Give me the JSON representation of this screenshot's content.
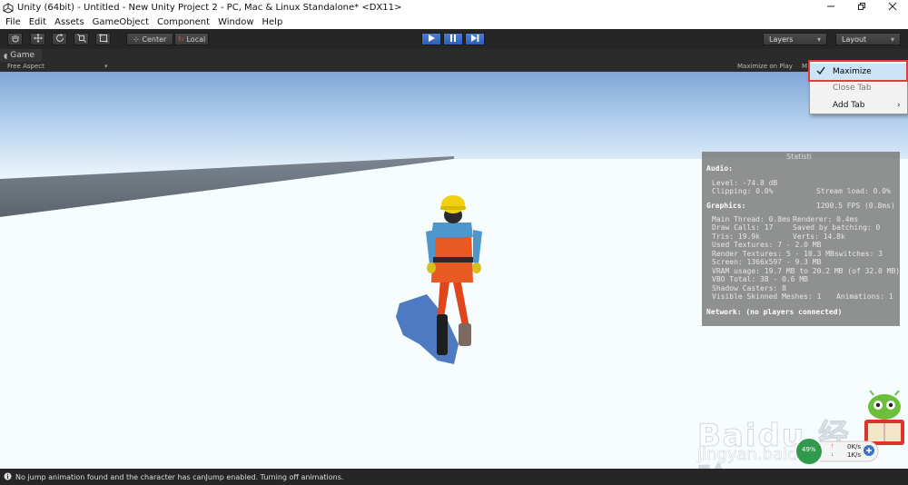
{
  "window": {
    "title": "Unity (64bit) - Untitled - New Unity Project 2 - PC, Mac & Linux Standalone* <DX11>",
    "controls": [
      "minimize",
      "maximize",
      "close"
    ]
  },
  "menubar": {
    "items": [
      "File",
      "Edit",
      "Assets",
      "GameObject",
      "Component",
      "Window",
      "Help"
    ]
  },
  "toolbar": {
    "tools": [
      "hand-tool",
      "move-tool",
      "rotate-tool",
      "scale-tool",
      "rect-tool"
    ],
    "pivot_label": "Center",
    "space_label": "Local",
    "playback": [
      "play",
      "pause",
      "step"
    ],
    "layers_label": "Layers",
    "layout_label": "Layout"
  },
  "game_tab": {
    "label": "Game",
    "aspect_label": "Free Aspect",
    "maximize_on_play": "Maximize on Play",
    "mute_partial": "M"
  },
  "stats": {
    "header_partial": "Statisti",
    "audio_heading": "Audio:",
    "level": "Level: -74.8 dB",
    "clipping": "Clipping: 0.0%",
    "stream_load": "Stream load: 0.0%",
    "graphics_heading": "Graphics:",
    "fps": "1200.5 FPS (0.8ms)",
    "main_thread": "Main Thread: 0.8ms",
    "renderer": "Renderer: 0.4ms",
    "draw_calls": "Draw Calls: 17",
    "saved_batching": "Saved by batching: 0",
    "tris": "Tris: 19.9k",
    "verts": "Verts: 14.8k",
    "used_textures": "Used Textures: 7 - 2.0 MB",
    "render_textures": "Render Textures: 5 - 10.3 MB",
    "switches": "switches: 3",
    "screen": "Screen: 1366x597 - 9.3 MB",
    "vram": "VRAM usage: 19.7 MB to 20.2 MB (of 32.0 MB)",
    "vbo": "VBO Total: 38 - 0.6 MB",
    "shadow_casters": "Shadow Casters: 8",
    "skinned_meshes": "Visible Skinned Meshes: 1",
    "animations": "Animations: 1",
    "network": "Network: (no players connected)"
  },
  "context_menu": {
    "items": [
      {
        "label": "Maximize",
        "checked": true
      },
      {
        "label": "Close Tab",
        "disabled": true
      },
      {
        "label": "Add Tab",
        "submenu": true
      }
    ]
  },
  "status": {
    "message": "No jump animation found and the character has canJump enabled. Turning off animations."
  },
  "watermark": {
    "brand": "Baidu 经验",
    "url": "jingyan.baidu.com"
  },
  "net_widget": {
    "percent": "49%",
    "up": "0K/s",
    "down": "1K/s"
  },
  "colors": {
    "accent_play": "#3a6fc8",
    "highlight": "#e23b3b",
    "sky_top": "#7fa6d8",
    "floor": "#f8fcfe"
  }
}
